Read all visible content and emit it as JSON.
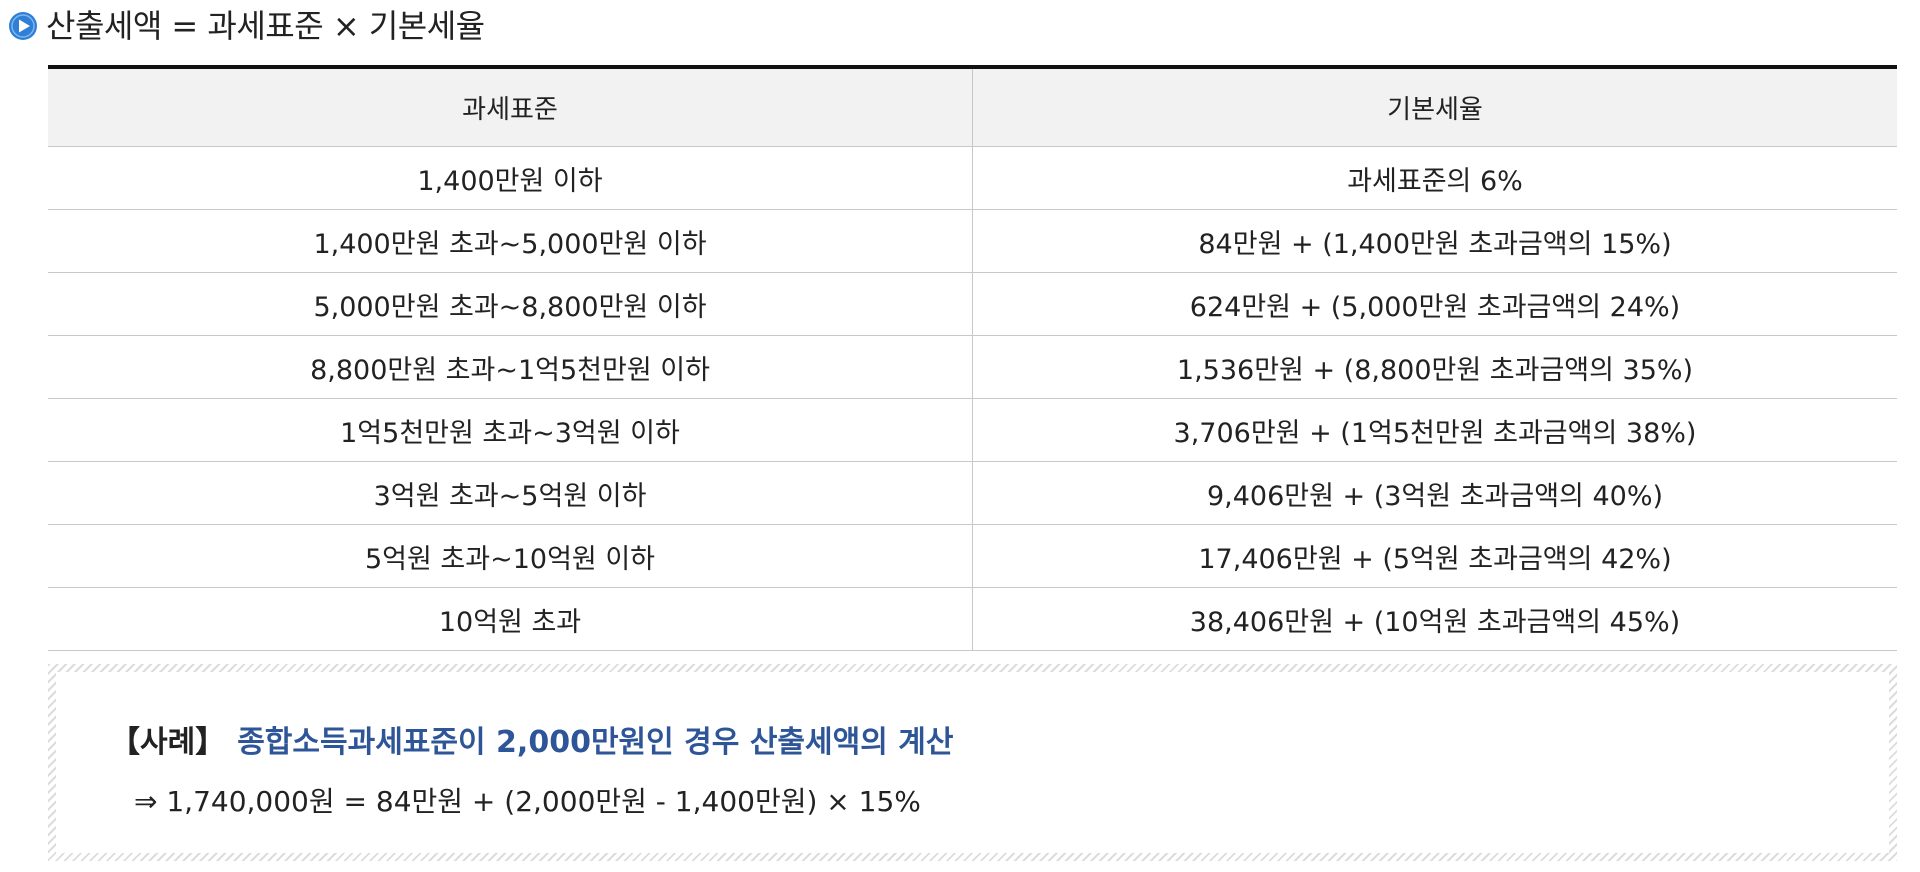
{
  "heading": {
    "icon": "play-circle-icon",
    "text": "산출세액 = 과세표준 × 기본세율"
  },
  "table": {
    "headers": [
      "과세표준",
      "기본세율"
    ],
    "rows": [
      [
        "1,400만원 이하",
        "과세표준의 6%"
      ],
      [
        "1,400만원 초과~5,000만원 이하",
        "84만원 + (1,400만원 초과금액의 15%)"
      ],
      [
        "5,000만원 초과~8,800만원 이하",
        "624만원 + (5,000만원 초과금액의 24%)"
      ],
      [
        "8,800만원 초과~1억5천만원 이하",
        "1,536만원 + (8,800만원 초과금액의 35%)"
      ],
      [
        "1억5천만원 초과~3억원 이하",
        "3,706만원 + (1억5천만원 초과금액의 38%)"
      ],
      [
        "3억원 초과~5억원 이하",
        "9,406만원 + (3억원 초과금액의 40%)"
      ],
      [
        "5억원 초과~10억원 이하",
        "17,406만원 + (5억원 초과금액의 42%)"
      ],
      [
        "10억원 초과",
        "38,406만원 + (10억원 초과금액의 45%)"
      ]
    ]
  },
  "example": {
    "label": "【사례】",
    "headline": "종합소득과세표준이 2,000만원인 경우 산출세액의 계산",
    "formula": "⇒ 1,740,000원 = 84만원 + (2,000만원 - 1,400만원) × 15%"
  },
  "colors": {
    "icon": "#2f7fd6",
    "headline": "#2e5597",
    "header_bg": "#f2f2f2",
    "border": "#c8c8c8"
  }
}
